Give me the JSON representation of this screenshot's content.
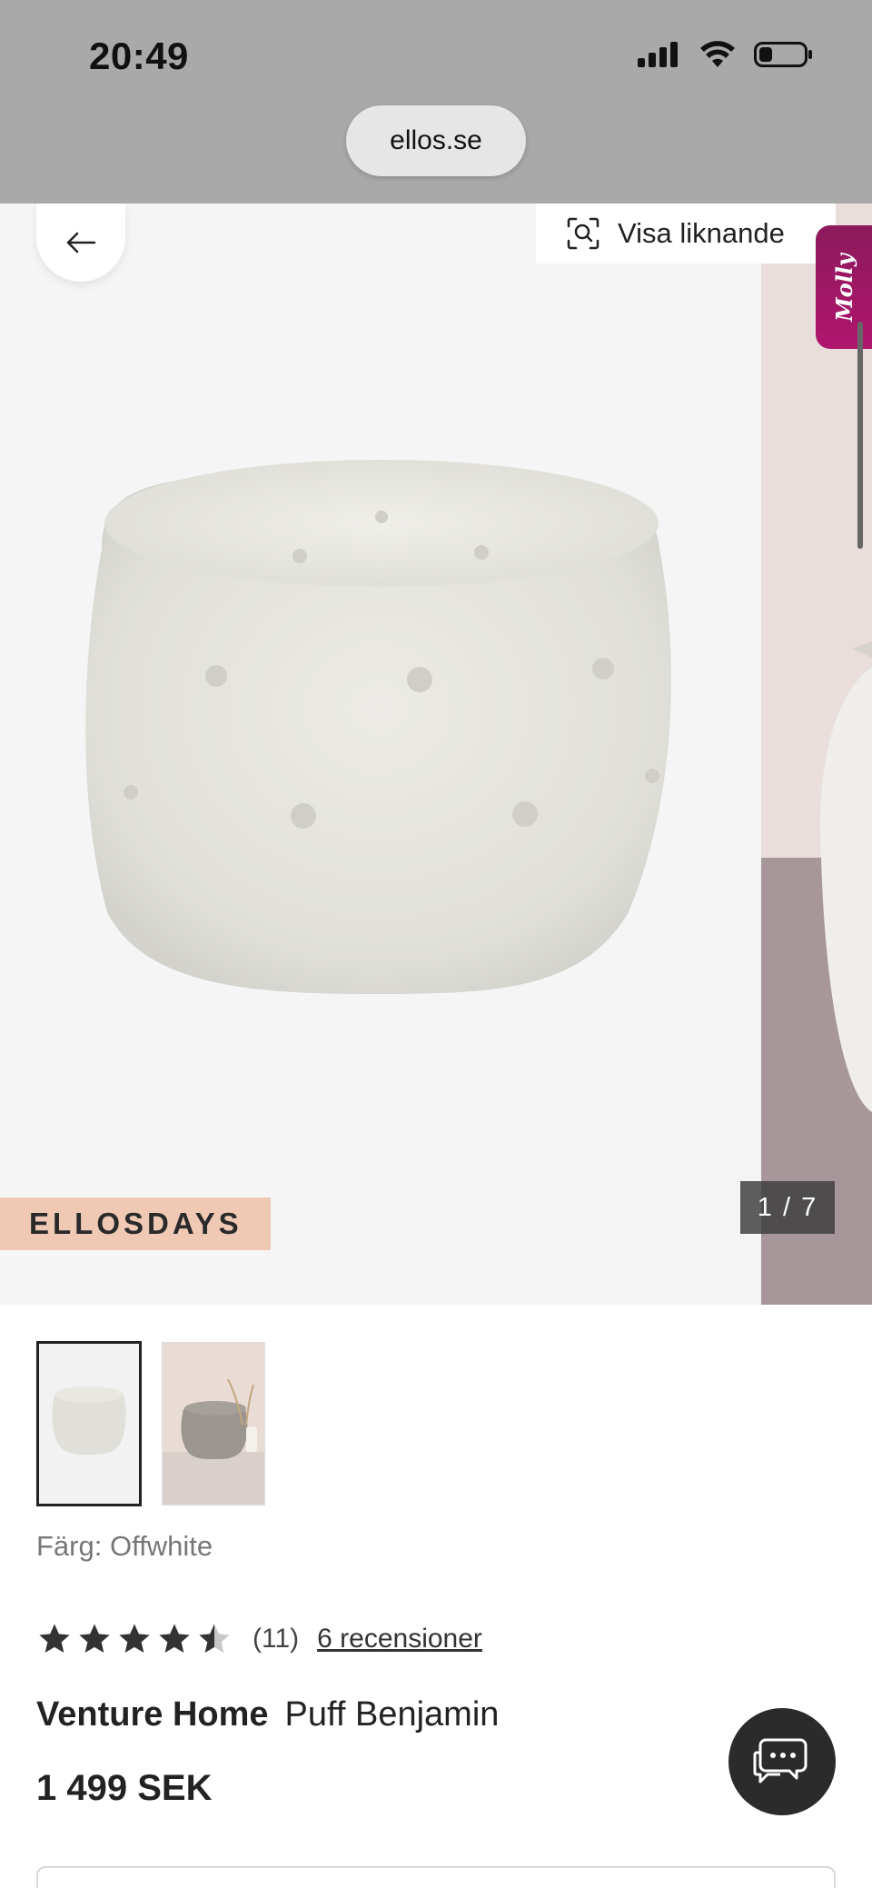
{
  "status_bar": {
    "time": "20:49"
  },
  "browser": {
    "url": "ellos.se"
  },
  "hero": {
    "visa_liknande_label": "Visa liknande",
    "molly_label": "Molly",
    "badge": "ELLOSDAYS",
    "counter": "1 / 7"
  },
  "product": {
    "color_label": "Färg: Offwhite",
    "rating_value": 4.5,
    "rating_count": "(11)",
    "reviews_link": "6 recensioner",
    "brand": "Venture Home",
    "name": "Puff Benjamin",
    "price": "1 499 SEK"
  },
  "colors": {
    "status_bar_bg": "#a9a9a9",
    "badge_bg": "#efc9b4",
    "molly_accent": "#a0166a",
    "chat_button": "#2b2b2b"
  }
}
